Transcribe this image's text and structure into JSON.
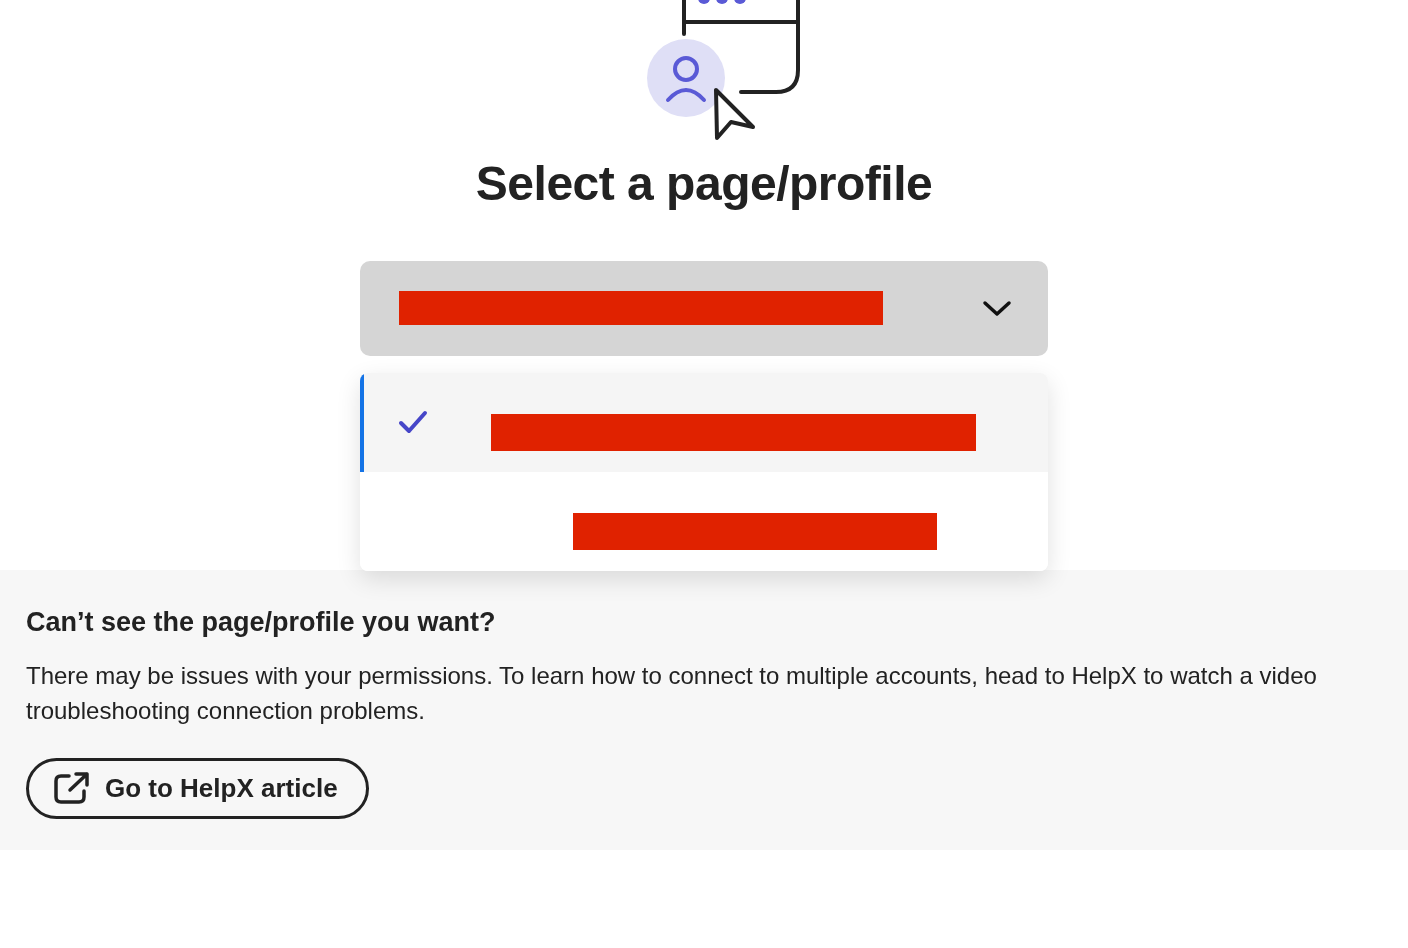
{
  "title": "Select a page/profile",
  "dropdown": {
    "expanded": true,
    "redacted": true
  },
  "options": [
    {
      "selected": true,
      "redacted": true
    },
    {
      "selected": false,
      "redacted": true
    }
  ],
  "help": {
    "heading": "Can’t see the page/profile you want?",
    "body": "There may be issues with your permissions. To learn how to connect to multiple accounts, head to HelpX to watch a video troubleshooting connection problems.",
    "button": "Go to HelpX article"
  }
}
